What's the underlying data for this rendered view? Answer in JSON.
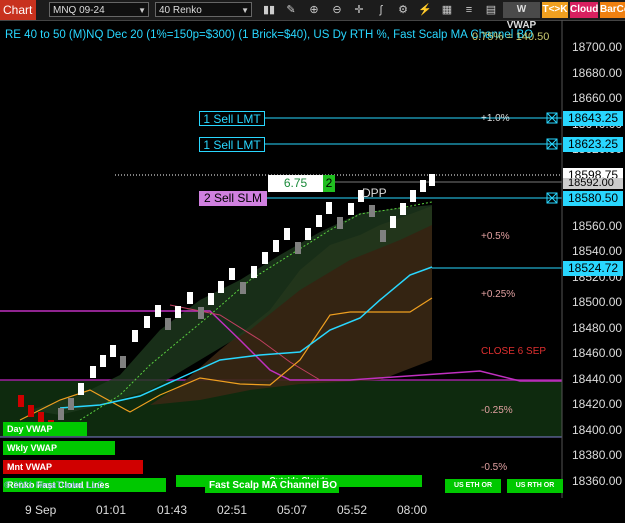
{
  "toolbar": {
    "chart_label": "Chart",
    "instrument": "MNQ 09-24",
    "bar_type": "40 Renko",
    "wvwap_label": "W VWAP",
    "tk_label": "T<>K",
    "cloud_label": "Cloud",
    "barcolor_label": "BarCo"
  },
  "header": {
    "description": "RE 40 to 50 (M)NQ Dec 20 (1%=150p=$300) (1 Brick=$40), US Dy RTH %, Fast Scalp MA Channel BO",
    "right_label": "0.75% = 140.50"
  },
  "price_axis": {
    "ticks": [
      "18700.00",
      "18680.00",
      "18660.00",
      "18640.00",
      "18620.00",
      "18600.00",
      "18580.00",
      "18560.00",
      "18540.00",
      "18520.00",
      "18500.00",
      "18480.00",
      "18460.00",
      "18440.00",
      "18420.00",
      "18400.00",
      "18380.00",
      "18360.00"
    ],
    "box_order1": "18643.25",
    "box_order2": "18623.25",
    "box_last": "18598.75",
    "box_prev": "18592.00",
    "box_stop": "18580.50",
    "box_level": "18524.72"
  },
  "time_axis": [
    "9 Sep",
    "01:01",
    "01:43",
    "02:51",
    "05:07",
    "05:52",
    "08:00"
  ],
  "orders": {
    "sell_lmt_1": "1 Sell LMT",
    "sell_lmt_2": "1 Sell LMT",
    "sell_slm": "2 Sell SLM",
    "qty_price": "6.75",
    "qty": "2",
    "dpp": "DPP"
  },
  "levels": {
    "pct_plus_1": "+1.0%",
    "pct_plus_05": "+0.5%",
    "pct_plus_025": "+0.25%",
    "close_label": "CLOSE 6 SEP",
    "pct_minus_025": "-0.25%",
    "pct_minus_05": "-0.5%"
  },
  "vwap_labels": {
    "day": "Day VWAP",
    "weekly": "Wkly VWAP",
    "monthly": "Mnt VWAP",
    "copyright": "© 2021 NinjaTrader, LLC",
    "renko_lines": "Renko Fast Cloud Lines",
    "fast_scalp": "Fast Scalp MA Channel BO",
    "outside_clouds": "Outside Clouds",
    "us_eth": "US ETH OR",
    "us_rth": "US RTH OR"
  },
  "colors": {
    "accent_cyan": "#29d7ff",
    "bull_brick": "#ffffff",
    "bear_brick": "#808080",
    "green": "#00c800",
    "red": "#d00000",
    "magenta": "#c030c0"
  }
}
